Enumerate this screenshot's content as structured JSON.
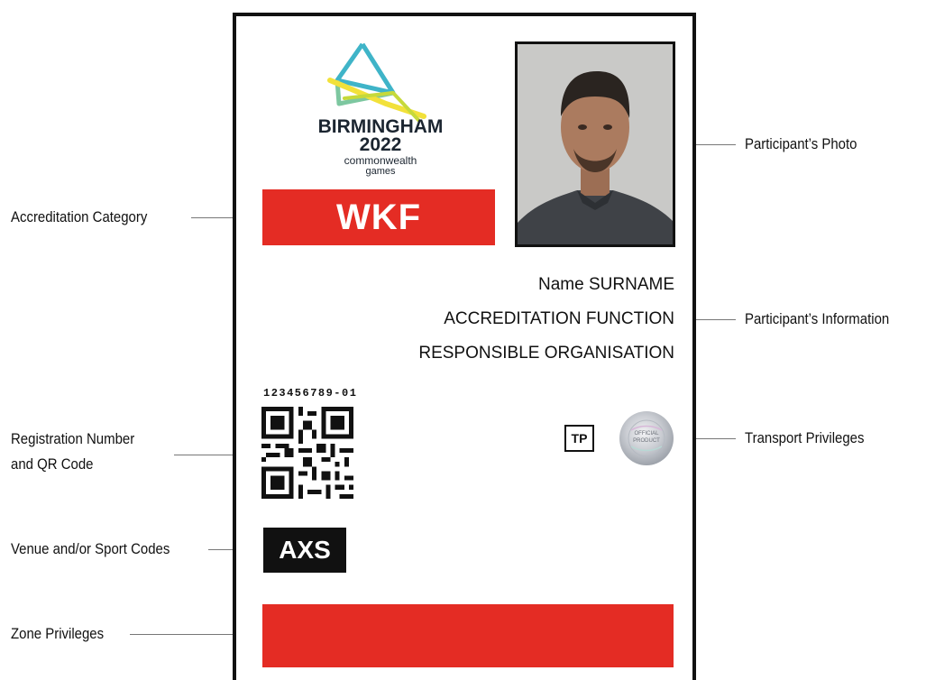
{
  "labels": {
    "accreditation_category": "Accreditation Category",
    "participant_photo": "Participant’s Photo",
    "participant_information": "Participant’s Information",
    "registration_line1": "Registration Number",
    "registration_line2": "and QR Code",
    "transport_privileges": "Transport Privileges",
    "venue_sport_codes": "Venue and/or Sport Codes",
    "zone_privileges": "Zone Privileges"
  },
  "card": {
    "logo": {
      "line1": "BIRMINGHAM",
      "line2": "2022",
      "line3": "commonwealth",
      "line4": "games"
    },
    "category_code": "WKF",
    "name": "Name SURNAME",
    "function": "ACCREDITATION FUNCTION",
    "organisation": "RESPONSIBLE ORGANISATION",
    "registration_number": "123456789-01",
    "transport_code": "TP",
    "hologram_text": "OFFICIAL PRODUCT",
    "venue_code": "AXS"
  },
  "colors": {
    "accent_red": "#e42c24",
    "ink": "#111111",
    "logo_teal": "#3fb4c8",
    "logo_yellow": "#f2e13a"
  }
}
